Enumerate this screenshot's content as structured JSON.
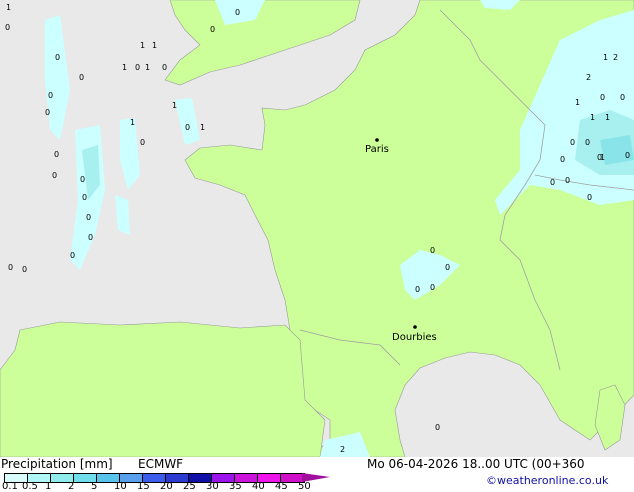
{
  "map": {
    "colors": {
      "sea": "#e9e9e9",
      "land": "#ccff99",
      "precip_light": "#ccffff",
      "precip_mid": "#a8f0f0",
      "precip_strong": "#88e4e8",
      "border": "#a0a0a0"
    },
    "cities": [
      {
        "name": "Paris"
      },
      {
        "name": "Dourbies"
      }
    ],
    "value_labels": [
      "0",
      "1",
      "0",
      "0",
      "0",
      "0",
      "0",
      "0",
      "0",
      "0",
      "0",
      "0",
      "0",
      "0",
      "0",
      "1",
      "1",
      "1",
      "1",
      "0",
      "1",
      "0",
      "1",
      "0",
      "1",
      "0",
      "0",
      "0",
      "1",
      "2",
      "2",
      "0",
      "0",
      "1",
      "1",
      "1",
      "0",
      "0",
      "1",
      "0",
      "0",
      "0",
      "0",
      "2",
      "0",
      "0",
      "0",
      "0",
      "0",
      "0",
      "0"
    ]
  },
  "legend": {
    "title": "Precipitation [mm]",
    "model": "ECMWF",
    "datetime": "Mo 06-04-2026 18..00 UTC (00+360",
    "credit": "©weatheronline.co.uk",
    "ticks": [
      "0.1",
      "0.5",
      "1",
      "2",
      "5",
      "10",
      "15",
      "20",
      "25",
      "30",
      "35",
      "40",
      "45",
      "50"
    ],
    "colors": [
      "#d8fcfc",
      "#b0f8f8",
      "#90ecec",
      "#70dcec",
      "#58c4ec",
      "#58a0ec",
      "#3c5cec",
      "#2c3cd0",
      "#1010a8",
      "#9c14ec",
      "#cc14dc",
      "#f014ec",
      "#d010c8",
      "#a0109c"
    ]
  }
}
